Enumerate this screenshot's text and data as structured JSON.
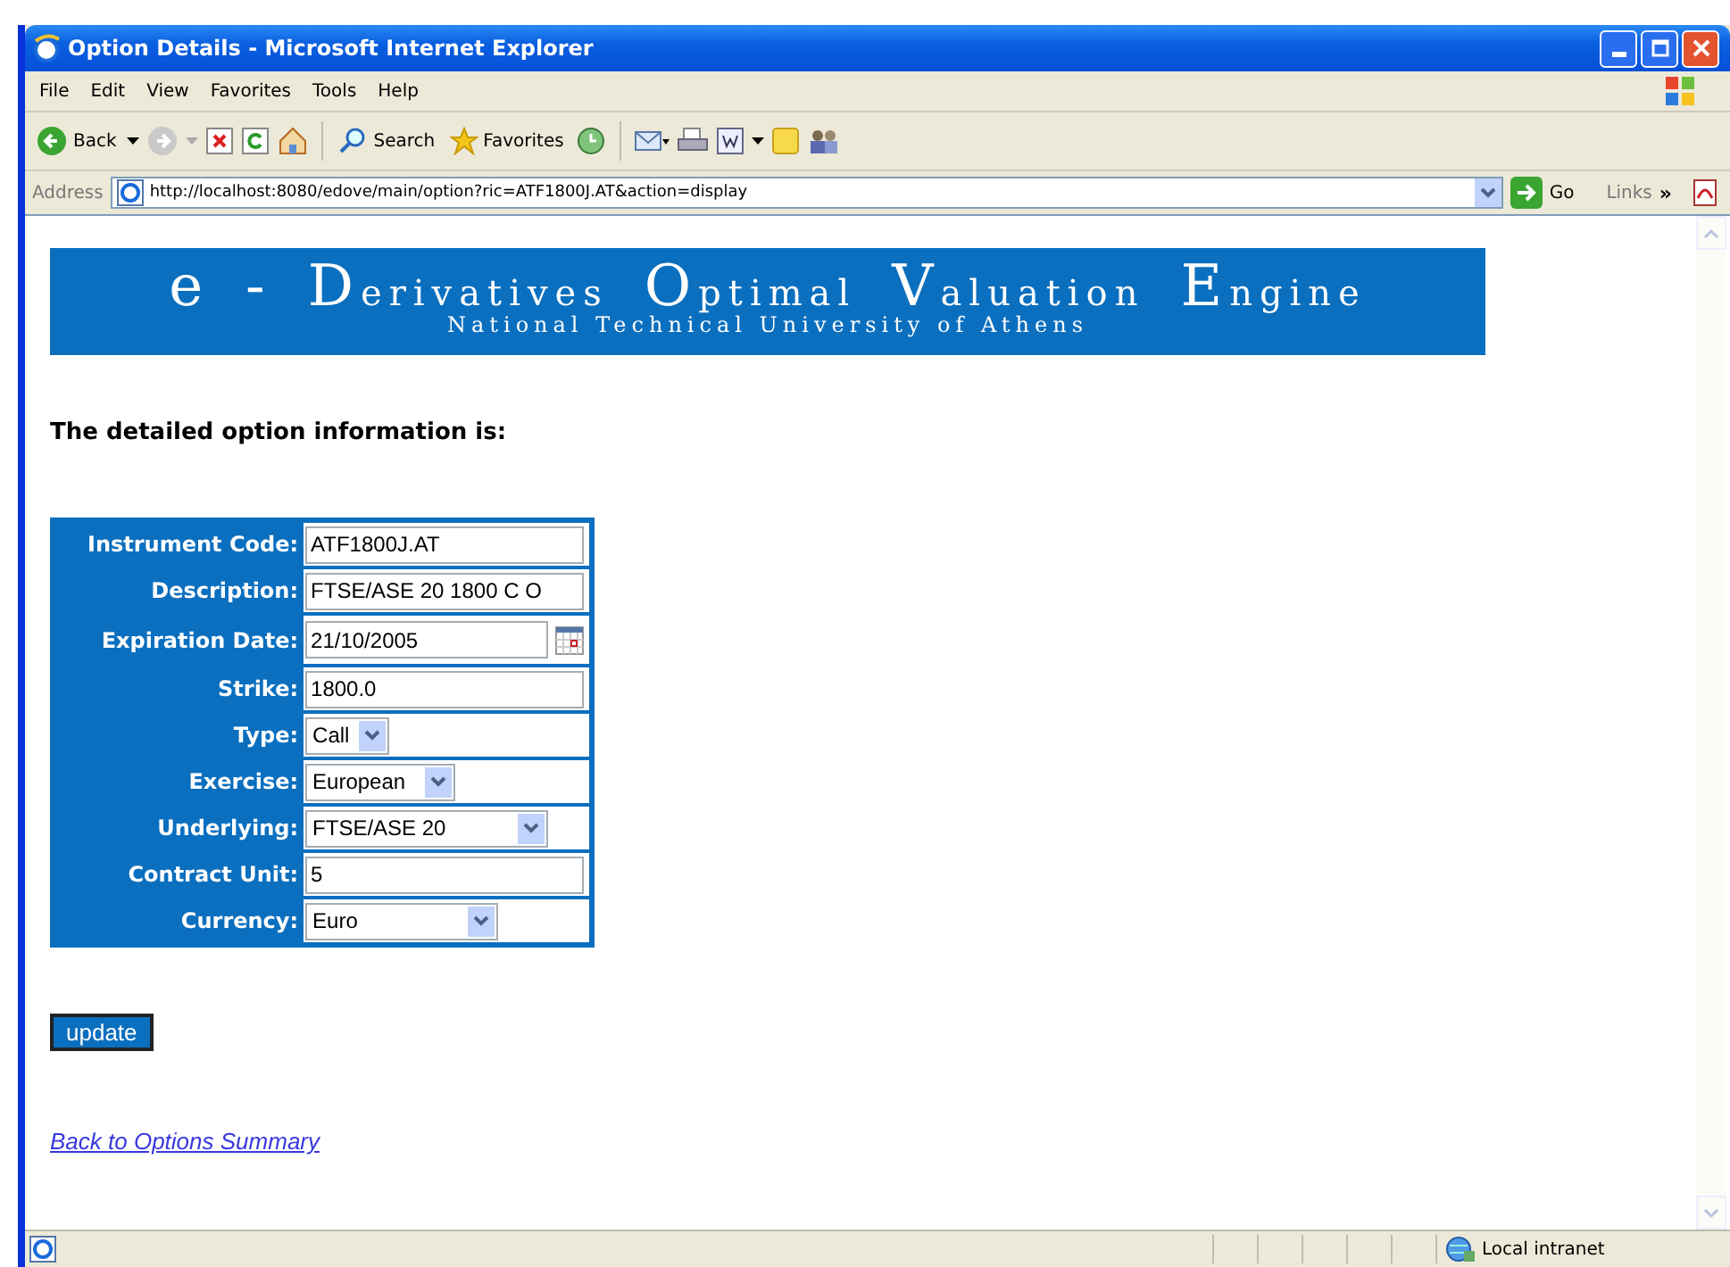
{
  "window": {
    "title": "Option Details - Microsoft Internet Explorer"
  },
  "menu": [
    "File",
    "Edit",
    "View",
    "Favorites",
    "Tools",
    "Help"
  ],
  "toolbar": {
    "back": "Back",
    "search": "Search",
    "favorites": "Favorites"
  },
  "address_bar": {
    "label": "Address",
    "url": "http://localhost:8080/edove/main/option?ric=ATF1800J.AT&action=display",
    "go": "Go",
    "links": "Links",
    "links_more": "»"
  },
  "banner": {
    "title_words": [
      "e",
      "-",
      "Derivatives",
      "Optimal",
      "Valuation",
      "Engine"
    ],
    "subtitle": "National Technical University of Athens"
  },
  "heading": "The detailed option information is:",
  "form": [
    {
      "label": "Instrument Code:",
      "kind": "text",
      "value": "ATF1800J.AT"
    },
    {
      "label": "Description:",
      "kind": "text",
      "value": "FTSE/ASE 20 1800 C O"
    },
    {
      "label": "Expiration Date:",
      "kind": "date",
      "value": "21/10/2005"
    },
    {
      "label": "Strike:",
      "kind": "text",
      "value": "1800.0"
    },
    {
      "label": "Type:",
      "kind": "select",
      "value": "Call"
    },
    {
      "label": "Exercise:",
      "kind": "select",
      "value": "European"
    },
    {
      "label": "Underlying:",
      "kind": "select",
      "value": "FTSE/ASE 20"
    },
    {
      "label": "Contract Unit:",
      "kind": "text",
      "value": "5"
    },
    {
      "label": "Currency:",
      "kind": "select",
      "value": "Euro"
    }
  ],
  "button": "update",
  "link": "Back to Options Summary",
  "status_bar": {
    "zone": "Local intranet"
  }
}
